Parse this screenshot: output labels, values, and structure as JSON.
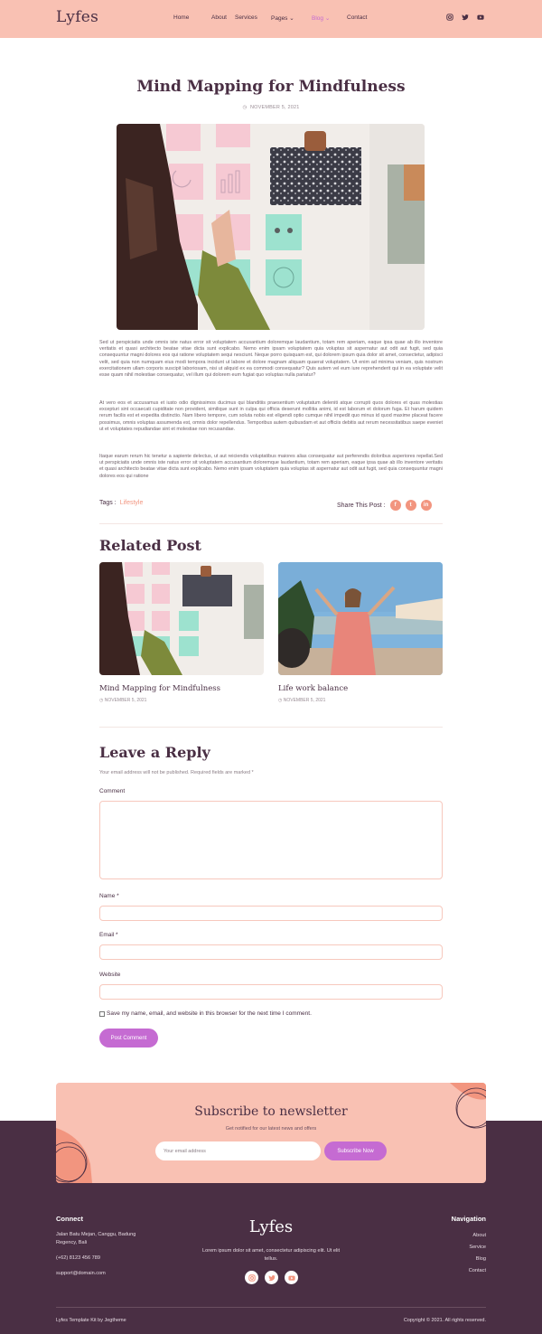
{
  "header": {
    "logo": "Lyfes",
    "nav": [
      "Home",
      "About",
      "Services",
      "Pages",
      "Blog",
      "Contact"
    ],
    "active_nav": "Blog",
    "social_icons": [
      "instagram-icon",
      "twitter-icon",
      "youtube-icon"
    ]
  },
  "post": {
    "title": "Mind Mapping for Mindfulness",
    "date": "NOVEMBER 5, 2021",
    "paragraphs": [
      "Sed ut perspiciatis unde omnis iste natus error sit voluptatem accusantium doloremque laudantium, totam rem aperiam, eaque ipsa quae ab illo inventore veritatis et quasi architecto beatae vitae dicta sunt explicabo. Nemo enim ipsam voluptatem quia voluptas sit aspernatur aut odit aut fugit, sed quia consequuntur magni dolores eos qui ratione voluptatem sequi nesciunt. Neque porro quisquam est, qui dolorem ipsum quia dolor sit amet, consectetur, adipisci velit, sed quia non numquam eius modi tempora incidunt ut labore et dolore magnam aliquam quaerat voluptatem. Ut enim ad minima veniam, quis nostrum exercitationem ullam corporis suscipit laboriosam, nisi ut aliquid ex ea commodi consequatur? Quis autem vel eum iure reprehenderit qui in ea voluptate velit esse quam nihil molestiae consequatur, vel illum qui dolorem eum fugiat quo voluptas nulla pariatur?",
      "At vero eos et accusamus et iusto odio dignissimos ducimus qui blanditiis praesentium voluptatum deleniti atque corrupti quos dolores et quas molestias excepturi sint occaecati cupiditate non provident, similique sunt in culpa qui officia deserunt mollitia animi, id est laborum et dolorum fuga. Et harum quidem rerum facilis est et expedita distinctio. Nam libero tempore, cum soluta nobis est eligendi optio cumque nihil impedit quo minus id quod maxime placeat facere possimus, omnis voluptas assumenda est, omnis dolor repellendus. Temporibus autem quibusdam et aut officiis debitis aut rerum necessitatibus saepe eveniet ut et voluptates repudiandae sint et molestiae non recusandae.",
      "Itaque earum rerum hic tenetur a sapiente delectus, ut aut reiciendis voluptatibus maiores alias consequatur aut perferendis doloribus asperiores repellat.Sed ut perspiciatis unde omnis iste natus error sit voluptatem accusantium doloremque laudantium, totam rem aperiam, eaque ipsa quae ab illo inventore veritatis et quasi architecto beatae vitae dicta sunt explicabo. Nemo enim ipsam voluptatem quia voluptas sit aspernatur aut odit aut fugit, sed quia consequuntur magni dolores eos qui ratione"
    ],
    "tags_label": "Tags :",
    "tag": "Lifestyle",
    "share_label": "Share This Post :",
    "share_icons": [
      "facebook-icon",
      "twitter-icon",
      "linkedin-icon"
    ]
  },
  "related": {
    "heading": "Related Post",
    "items": [
      {
        "title": "Mind Mapping for Mindfulness",
        "date": "NOVEMBER 5, 2021"
      },
      {
        "title": "Life work balance",
        "date": "NOVEMBER 5, 2021"
      }
    ]
  },
  "reply": {
    "heading": "Leave a Reply",
    "note": "Your email address will not be published. Required fields are marked *",
    "comment_label": "Comment",
    "name_label": "Name *",
    "email_label": "Email *",
    "website_label": "Website",
    "save_label": "Save my name, email, and website in this browser for the next time I comment.",
    "submit_label": "Post Comment"
  },
  "newsletter": {
    "title": "Subscribe to newsletter",
    "subtitle": "Get notified for our latest news and offers",
    "placeholder": "Your email address",
    "button": "Subscribe Now"
  },
  "footer": {
    "connect_heading": "Connect",
    "address": "Jalan Batu Mejan, Canggu, Badung Regency, Bali",
    "phone": "(+62) 8123 456 789",
    "email": "support@domain.com",
    "logo": "Lyfes",
    "description": "Lorem ipsum dolor sit amet, consectetur adipiscing elit. Ut elit tellus.",
    "nav_heading": "Navigation",
    "nav": [
      "About",
      "Service",
      "Blog",
      "Contact"
    ],
    "credit": "Lyfes Template Kit by Jegtheme",
    "copyright": "Copyright © 2021. All rights reserved."
  },
  "colors": {
    "header_bg": "#f9c1b3",
    "accent": "#c56bd2",
    "coral": "#f2957f",
    "footer_bg": "#4a2f44"
  }
}
